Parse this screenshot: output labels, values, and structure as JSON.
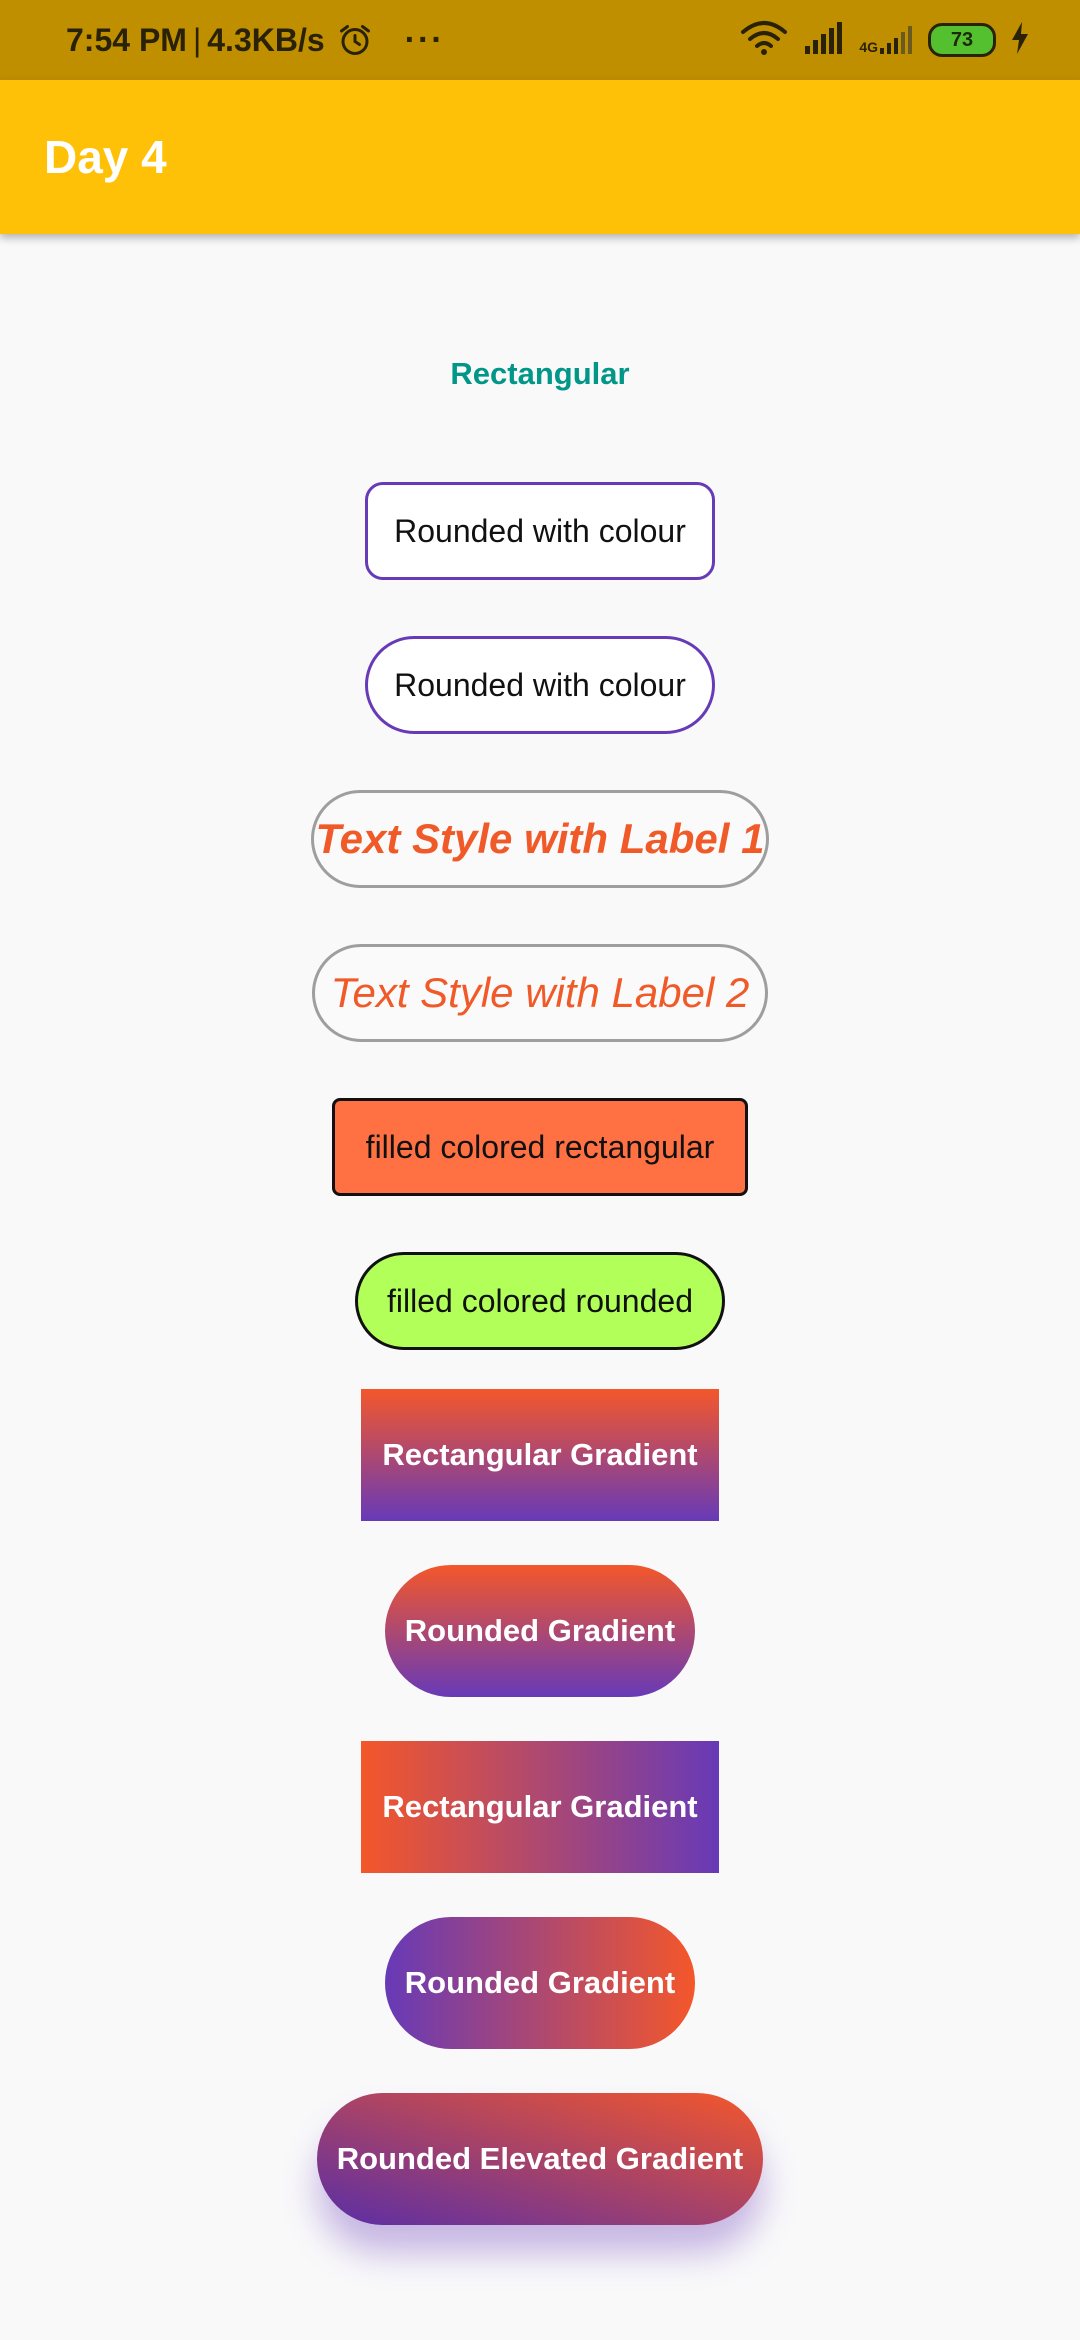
{
  "status_bar": {
    "time": "7:54 PM",
    "separator": "|",
    "speed": "4.3KB/s",
    "more_dots": "···",
    "network_type": "4G",
    "battery_level": "73",
    "icons": [
      "alarm-icon",
      "wifi-icon",
      "signal-icon",
      "signal-4g-icon",
      "battery-icon",
      "charging-icon"
    ]
  },
  "app_bar": {
    "title": "Day 4",
    "color": "#ffc107"
  },
  "buttons": {
    "text_button": "Rectangular",
    "outline_rounded_rect": "Rounded with colour",
    "outline_stadium": "Rounded with colour",
    "text_style_label_1": "Text Style with Label 1",
    "text_style_label_2": "Text Style with Label 2",
    "filled_rectangular": "filled colored rectangular",
    "filled_rounded": "filled colored rounded",
    "gradient_rect_vertical": "Rectangular Gradient",
    "gradient_round_vertical": "Rounded Gradient",
    "gradient_rect_horizontal": "Rectangular Gradient",
    "gradient_round_horizontal": "Rounded Gradient",
    "gradient_elevated": "Rounded Elevated Gradient"
  },
  "colors": {
    "accent_teal": "#009688",
    "outline_purple": "#673ab7",
    "label_orange": "#f05a28",
    "filled_orange": "#ff7043",
    "filled_green": "#b2ff59",
    "gradient_start": "#f4572a",
    "gradient_end": "#673ab7"
  }
}
